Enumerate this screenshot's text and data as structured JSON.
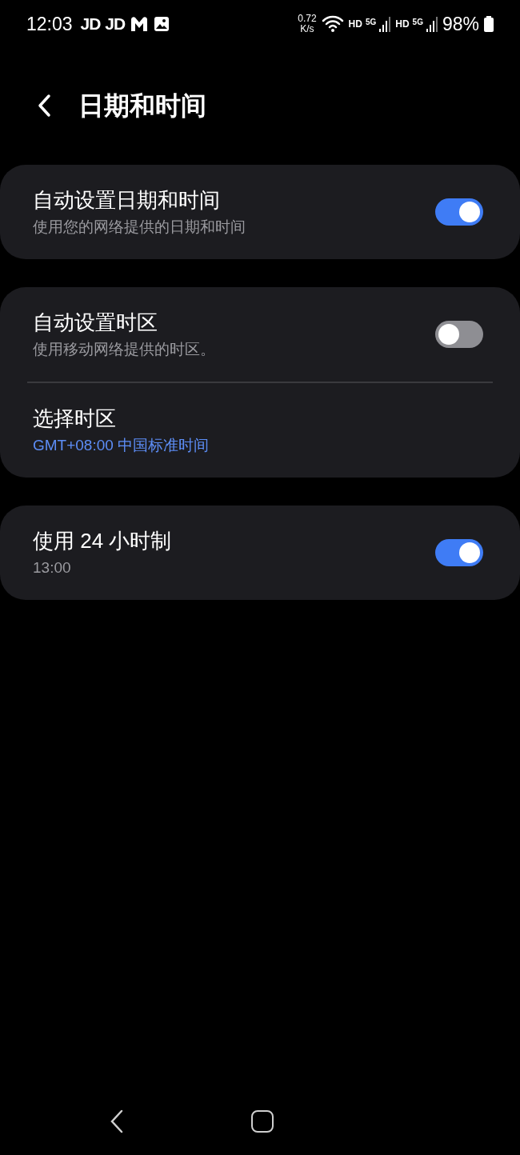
{
  "status_bar": {
    "time": "12:03",
    "notifications": [
      {
        "kind": "text",
        "label": "JD"
      },
      {
        "kind": "text",
        "label": "JD"
      },
      {
        "kind": "mail"
      },
      {
        "kind": "image"
      }
    ],
    "speed": {
      "value": "0.72",
      "unit": "K/s"
    },
    "networks": [
      {
        "label": "HD",
        "generation": "5G"
      },
      {
        "label": "HD",
        "generation": "5G"
      }
    ],
    "battery": "98%"
  },
  "header": {
    "title": "日期和时间"
  },
  "groups": [
    {
      "items": [
        {
          "kind": "toggle",
          "title": "自动设置日期和时间",
          "subtitle": "使用您的网络提供的日期和时间",
          "on": true
        }
      ]
    },
    {
      "items": [
        {
          "kind": "toggle",
          "title": "自动设置时区",
          "subtitle": "使用移动网络提供的时区。",
          "on": false
        },
        {
          "kind": "link",
          "title": "选择时区",
          "subtitle": "GMT+08:00 中国标准时间"
        }
      ]
    },
    {
      "items": [
        {
          "kind": "toggle",
          "title": "使用 24 小时制",
          "subtitle": "13:00",
          "on": true
        }
      ]
    }
  ],
  "nav_bar": {
    "buttons": [
      {
        "kind": "back"
      },
      {
        "kind": "home"
      }
    ]
  }
}
